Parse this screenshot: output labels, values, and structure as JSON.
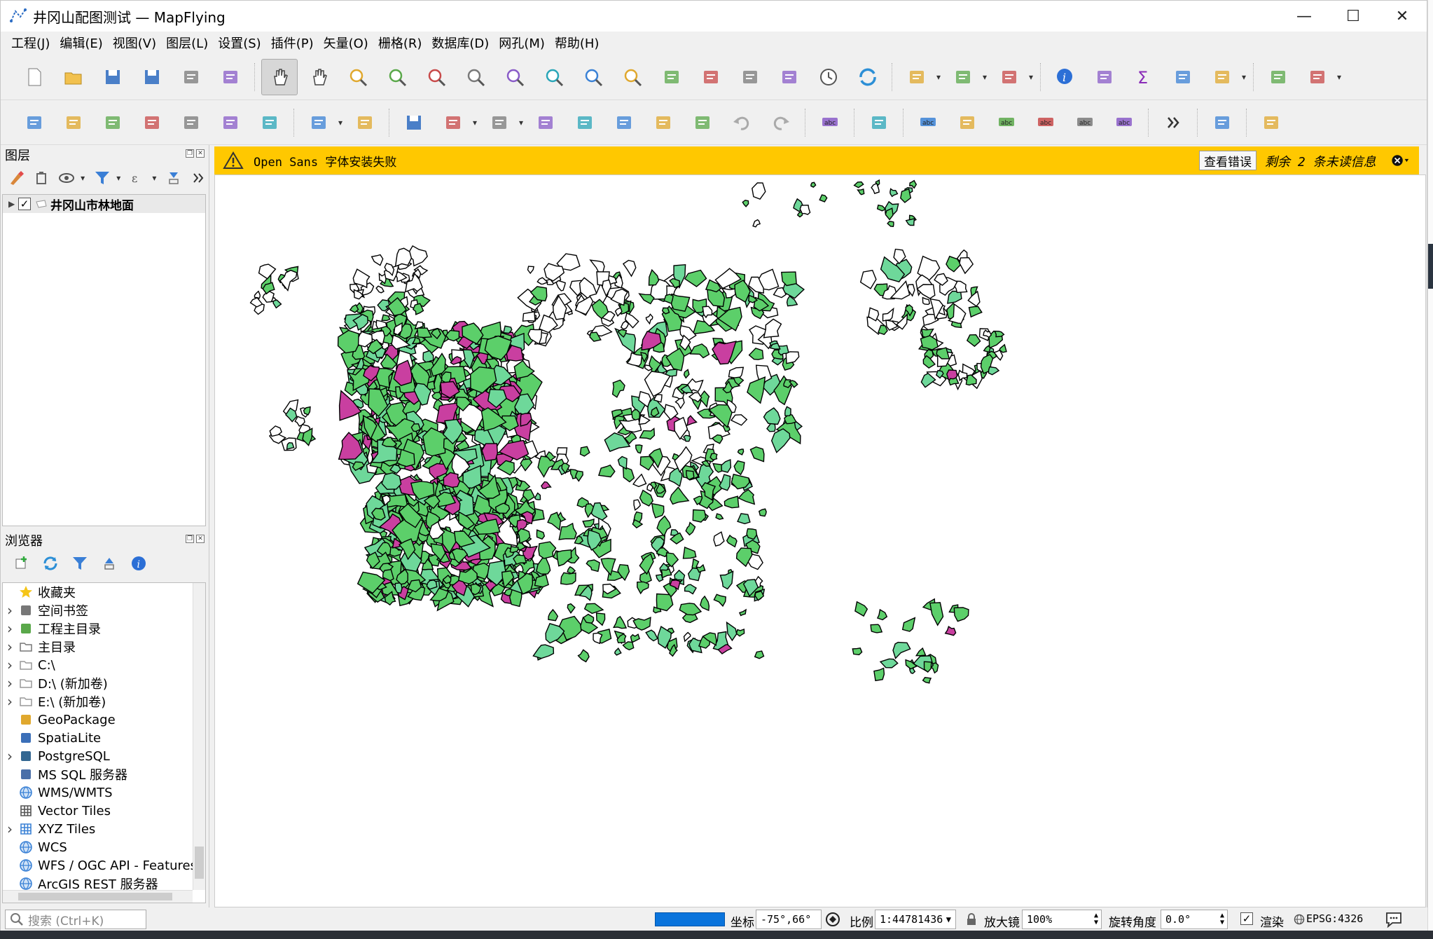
{
  "window": {
    "title": "井冈山配图测试 — MapFlying",
    "minimize_glyph": "—",
    "maximize_glyph": "☐",
    "close_glyph": "✕"
  },
  "menu": [
    "工程(J)",
    "编辑(E)",
    "视图(V)",
    "图层(L)",
    "设置(S)",
    "插件(P)",
    "矢量(O)",
    "栅格(R)",
    "数据库(D)",
    "网孔(M)",
    "帮助(H)"
  ],
  "toolbar1_icons": [
    "new-project-icon",
    "open-project-icon",
    "save-project-icon",
    "save-as-icon",
    "print-layout-icon",
    "style-manager-icon",
    "pan-icon",
    "pan-to-selection-icon",
    "zoom-in-icon",
    "zoom-out-icon",
    "zoom-full-icon",
    "zoom-to-selection-icon",
    "zoom-to-layer-icon",
    "zoom-native-icon",
    "zoom-last-icon",
    "zoom-next-icon",
    "new-bookmark-icon",
    "show-bookmarks-icon",
    "map-tips-icon",
    "new-3d-view-icon",
    "temporal-controller-icon",
    "refresh-icon",
    "select-features-icon",
    "select-by-value-icon",
    "deselect-icon",
    "identify-icon",
    "attribute-table-icon",
    "statistics-icon",
    "field-calculator-icon",
    "measure-icon",
    "annotation-icon",
    "processing-toolbox-icon"
  ],
  "toolbar2_icons": [
    "data-source-manager-icon",
    "new-geopackage-layer-icon",
    "new-shapefile-layer-icon",
    "new-spatialite-layer-icon",
    "new-temporary-layer-icon",
    "new-virtual-layer-icon",
    "new-mesh-layer-icon",
    "current-edits-icon",
    "toggle-editing-icon",
    "save-edits-icon",
    "add-feature-icon",
    "vertex-tool-icon",
    "modify-attributes-icon",
    "delete-selected-icon",
    "cut-features-icon",
    "copy-features-icon",
    "paste-features-icon",
    "undo-icon",
    "redo-icon",
    "label-icon",
    "diagram-icon",
    "pin-labels-icon",
    "highlight-pinned-icon",
    "show-hide-labels-icon",
    "move-label-icon",
    "rotate-label-icon",
    "change-label-icon",
    "more-tools-icon",
    "help-icon",
    "plugin-icon"
  ],
  "layers_panel": {
    "title": "图层",
    "layers": [
      {
        "name": "井冈山市林地面",
        "checked": true
      }
    ]
  },
  "browser_panel": {
    "title": "浏览器",
    "items": [
      {
        "label": "收藏夹",
        "icon": "star-icon",
        "expandable": false
      },
      {
        "label": "空间书签",
        "icon": "bookmark-icon",
        "expandable": true
      },
      {
        "label": "工程主目录",
        "icon": "project-home-icon",
        "expandable": true
      },
      {
        "label": "主目录",
        "icon": "home-folder-icon",
        "expandable": true
      },
      {
        "label": "C:\\",
        "icon": "folder-icon",
        "expandable": true
      },
      {
        "label": "D:\\ (新加卷)",
        "icon": "folder-icon",
        "expandable": true
      },
      {
        "label": "E:\\ (新加卷)",
        "icon": "folder-icon",
        "expandable": true
      },
      {
        "label": "GeoPackage",
        "icon": "geopackage-icon",
        "expandable": false
      },
      {
        "label": "SpatiaLite",
        "icon": "spatialite-icon",
        "expandable": false
      },
      {
        "label": "PostgreSQL",
        "icon": "postgresql-icon",
        "expandable": true
      },
      {
        "label": "MS SQL 服务器",
        "icon": "mssql-icon",
        "expandable": false
      },
      {
        "label": "WMS/WMTS",
        "icon": "wms-icon",
        "expandable": false
      },
      {
        "label": "Vector Tiles",
        "icon": "vector-tiles-icon",
        "expandable": false
      },
      {
        "label": "XYZ Tiles",
        "icon": "xyz-tiles-icon",
        "expandable": true
      },
      {
        "label": "WCS",
        "icon": "wcs-icon",
        "expandable": false
      },
      {
        "label": "WFS / OGC API - Features",
        "icon": "wfs-icon",
        "expandable": false
      },
      {
        "label": "ArcGIS REST 服务器",
        "icon": "arcgis-icon",
        "expandable": false
      }
    ]
  },
  "message_bar": {
    "text": "Open Sans 字体安装失败",
    "button": "查看错误",
    "remaining": "剩余 2 条未读信息"
  },
  "status": {
    "search_placeholder": "搜索 (Ctrl+K)",
    "coord_label": "坐标",
    "coord_value": "-75°,66°",
    "scale_label": "比例",
    "scale_value": "1:44781436",
    "magnifier_label": "放大镜",
    "magnifier_value": "100%",
    "rotation_label": "旋转角度",
    "rotation_value": "0.0°",
    "render_label": "渲染",
    "render_checked": true,
    "crs": "EPSG:4326"
  },
  "map_colors": {
    "forest": "#5ccf6a",
    "forest_light": "#6ed89a",
    "shrub": "#c93fa0",
    "other": "#e8a445",
    "outline": "#000000"
  }
}
